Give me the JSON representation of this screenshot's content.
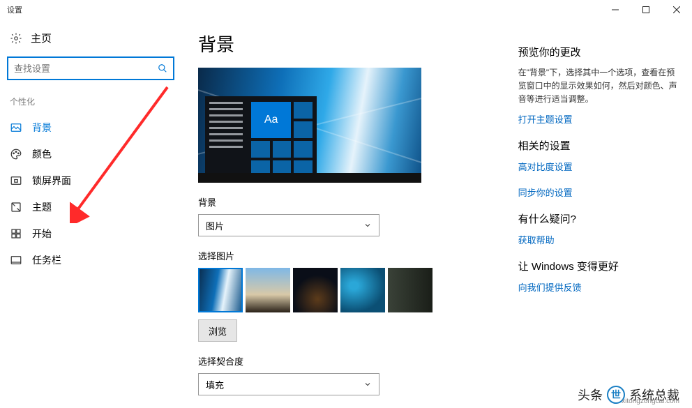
{
  "window": {
    "title": "设置"
  },
  "sidebar": {
    "home": "主页",
    "search_placeholder": "查找设置",
    "section": "个性化",
    "items": [
      {
        "label": "背景",
        "icon": "image-icon",
        "active": true
      },
      {
        "label": "颜色",
        "icon": "palette-icon",
        "active": false
      },
      {
        "label": "锁屏界面",
        "icon": "lockscreen-icon",
        "active": false
      },
      {
        "label": "主题",
        "icon": "theme-icon",
        "active": false
      },
      {
        "label": "开始",
        "icon": "start-icon",
        "active": false
      },
      {
        "label": "任务栏",
        "icon": "taskbar-icon",
        "active": false
      }
    ]
  },
  "page": {
    "title": "背景",
    "preview_tile_text": "Aa",
    "bg_label": "背景",
    "bg_value": "图片",
    "choose_label": "选择图片",
    "browse": "浏览",
    "fit_label": "选择契合度",
    "fit_value": "填充"
  },
  "right": {
    "preview_head": "预览你的更改",
    "preview_text": "在\"背景\"下，选择其中一个选项，查看在预览窗口中的显示效果如何，然后对颜色、声音等进行适当调整。",
    "theme_link": "打开主题设置",
    "related_head": "相关的设置",
    "contrast_link": "高对比度设置",
    "sync_link": "同步你的设置",
    "question_head": "有什么疑问?",
    "help_link": "获取帮助",
    "better_head": "让 Windows 变得更好",
    "feedback_link": "向我们提供反馈"
  },
  "watermark": {
    "prefix": "头条",
    "name": "系统总裁",
    "url": "xitongzongcai.com"
  }
}
